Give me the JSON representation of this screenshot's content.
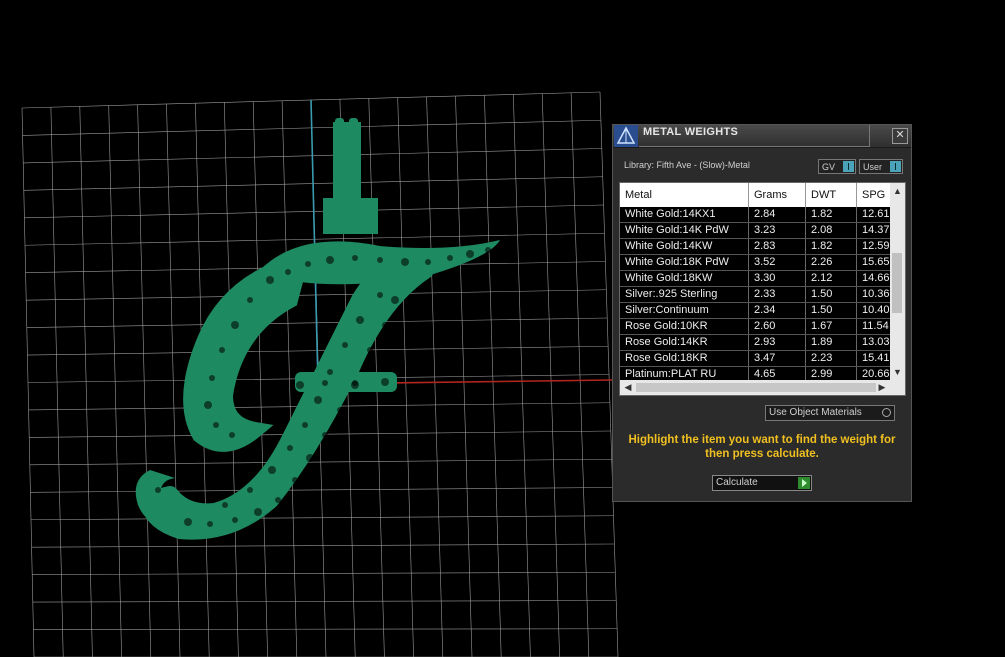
{
  "panel": {
    "title": "METAL WEIGHTS",
    "close_glyph": "✕",
    "library_label": "Library: Fifth Ave - (Slow)-Metal",
    "toggles": [
      "GV",
      "User"
    ],
    "columns": [
      "Metal",
      "Grams",
      "DWT",
      "SPG"
    ],
    "rows": [
      {
        "metal": "White Gold:14KX1",
        "grams": "2.84",
        "dwt": "1.82",
        "spg": "12.61"
      },
      {
        "metal": "White Gold:14K PdW",
        "grams": "3.23",
        "dwt": "2.08",
        "spg": "14.37"
      },
      {
        "metal": "White Gold:14KW",
        "grams": "2.83",
        "dwt": "1.82",
        "spg": "12.59"
      },
      {
        "metal": "White Gold:18K PdW",
        "grams": "3.52",
        "dwt": "2.26",
        "spg": "15.65"
      },
      {
        "metal": "White Gold:18KW",
        "grams": "3.30",
        "dwt": "2.12",
        "spg": "14.66"
      },
      {
        "metal": "Silver:.925 Sterling",
        "grams": "2.33",
        "dwt": "1.50",
        "spg": "10.36"
      },
      {
        "metal": "Silver:Continuum",
        "grams": "2.34",
        "dwt": "1.50",
        "spg": "10.40"
      },
      {
        "metal": "Rose Gold:10KR",
        "grams": "2.60",
        "dwt": "1.67",
        "spg": "11.54"
      },
      {
        "metal": "Rose Gold:14KR",
        "grams": "2.93",
        "dwt": "1.89",
        "spg": "13.03"
      },
      {
        "metal": "Rose Gold:18KR",
        "grams": "3.47",
        "dwt": "2.23",
        "spg": "15.41"
      },
      {
        "metal": "Platinum:PLAT RU",
        "grams": "4.65",
        "dwt": "2.99",
        "spg": "20.66"
      }
    ],
    "use_object_materials": "Use Object Materials",
    "hint": "Highlight the item you want to find the weight for then press calculate.",
    "calculate_label": "Calculate",
    "scroll_up": "▲",
    "scroll_down": "▼",
    "scroll_left": "◀",
    "scroll_right": "▶"
  },
  "viewport": {
    "model_color": "#1e8a62",
    "grid_color": "#d8d8d8",
    "axis_x_color": "#b3261e",
    "axis_y_color": "#3a9bb0"
  }
}
